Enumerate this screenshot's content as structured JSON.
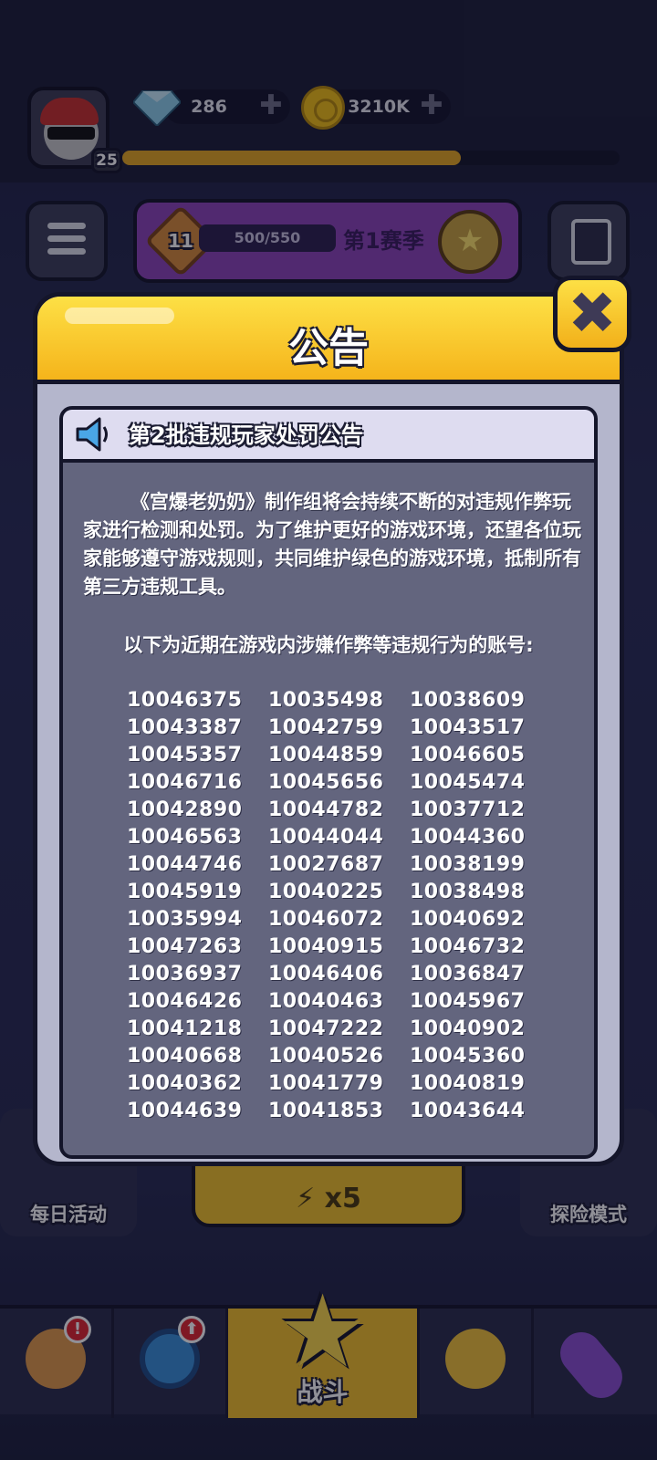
{
  "hud": {
    "player_level": "25",
    "gems": "286",
    "coins": "3210K",
    "xp_progress": 0.68,
    "plus": "✚"
  },
  "season": {
    "level": "11",
    "progress_text": "500/550",
    "title": "第1赛季"
  },
  "side_buttons": {
    "left_label": "每日活动",
    "right_label": "探险模式",
    "energy": "x5"
  },
  "bottom_nav": {
    "battle_label": "战斗",
    "shop_badge": "!",
    "gear_badge": "⬆"
  },
  "modal": {
    "title": "公告",
    "notice_title": "第2批违规玩家处罚公告",
    "paragraph": "《宫爆老奶奶》制作组将会持续不断的对违规作弊玩家进行检测和处罚。为了维护更好的游戏环境，还望各位玩家能够遵守游戏规则，共同维护绿色的游戏环境，抵制所有第三方违规工具。",
    "list_intro": "以下为近期在游戏内涉嫌作弊等违规行为的账号:",
    "account_ids": [
      "10046375",
      "10035498",
      "10038609",
      "10043387",
      "10042759",
      "10043517",
      "10045357",
      "10044859",
      "10046605",
      "10046716",
      "10045656",
      "10045474",
      "10042890",
      "10044782",
      "10037712",
      "10046563",
      "10044044",
      "10044360",
      "10044746",
      "10027687",
      "10038199",
      "10045919",
      "10040225",
      "10038498",
      "10035994",
      "10046072",
      "10040692",
      "10047263",
      "10040915",
      "10046732",
      "10036937",
      "10046406",
      "10036847",
      "10046426",
      "10040463",
      "10045967",
      "10041218",
      "10047222",
      "10040902",
      "10040668",
      "10040526",
      "10045360",
      "10040362",
      "10041779",
      "10040819",
      "10044639",
      "10041853",
      "10043644"
    ]
  },
  "colors": {
    "modal_header": "#f5b41b",
    "modal_body": "#63657e",
    "notice_head": "#dedcf0",
    "battle_active": "#f2c02a"
  }
}
